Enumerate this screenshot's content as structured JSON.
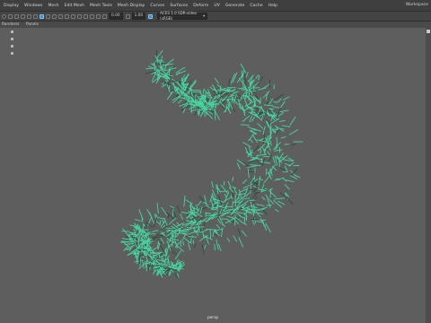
{
  "menu": {
    "items": [
      "Display",
      "Windows",
      "Mesh",
      "Edit Mesh",
      "Mesh Tools",
      "Mesh Display",
      "Curves",
      "Surfaces",
      "Deform",
      "UV",
      "Generate",
      "Cache",
      "Help"
    ],
    "workspace_label": "Workspace"
  },
  "toolbar": {
    "field_a": "0.00",
    "field_b": "1.00",
    "colorspace": "ACES 1.0 SDR-video (sRGB)"
  },
  "panel_menu": [
    "Renderer",
    "Panels"
  ],
  "viewport": {
    "camera_label": "persp",
    "fur_color": "#46d6a0",
    "background": "#5e5e5e"
  }
}
